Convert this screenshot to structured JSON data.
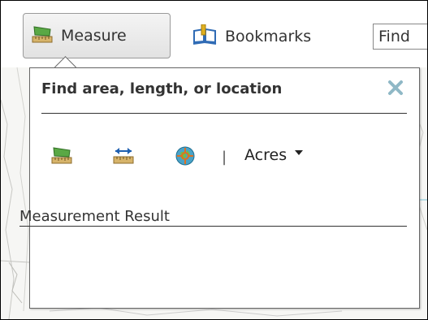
{
  "toolbar": {
    "measure_label": "Measure",
    "bookmarks_label": "Bookmarks",
    "find_placeholder": "Find"
  },
  "measure_panel": {
    "title": "Find area, length, or location",
    "separator": "|",
    "unit_selected": "Acres",
    "tools": [
      "area-tool-icon",
      "distance-tool-icon",
      "location-tool-icon"
    ],
    "result_label": "Measurement Result"
  },
  "colors": {
    "close_icon": "#8fb8c6",
    "ruler": "#c9a45a",
    "area_green": "#4e9c3d",
    "distance_blue": "#1e5fb0",
    "bookmark_blue": "#2f6bb5"
  }
}
